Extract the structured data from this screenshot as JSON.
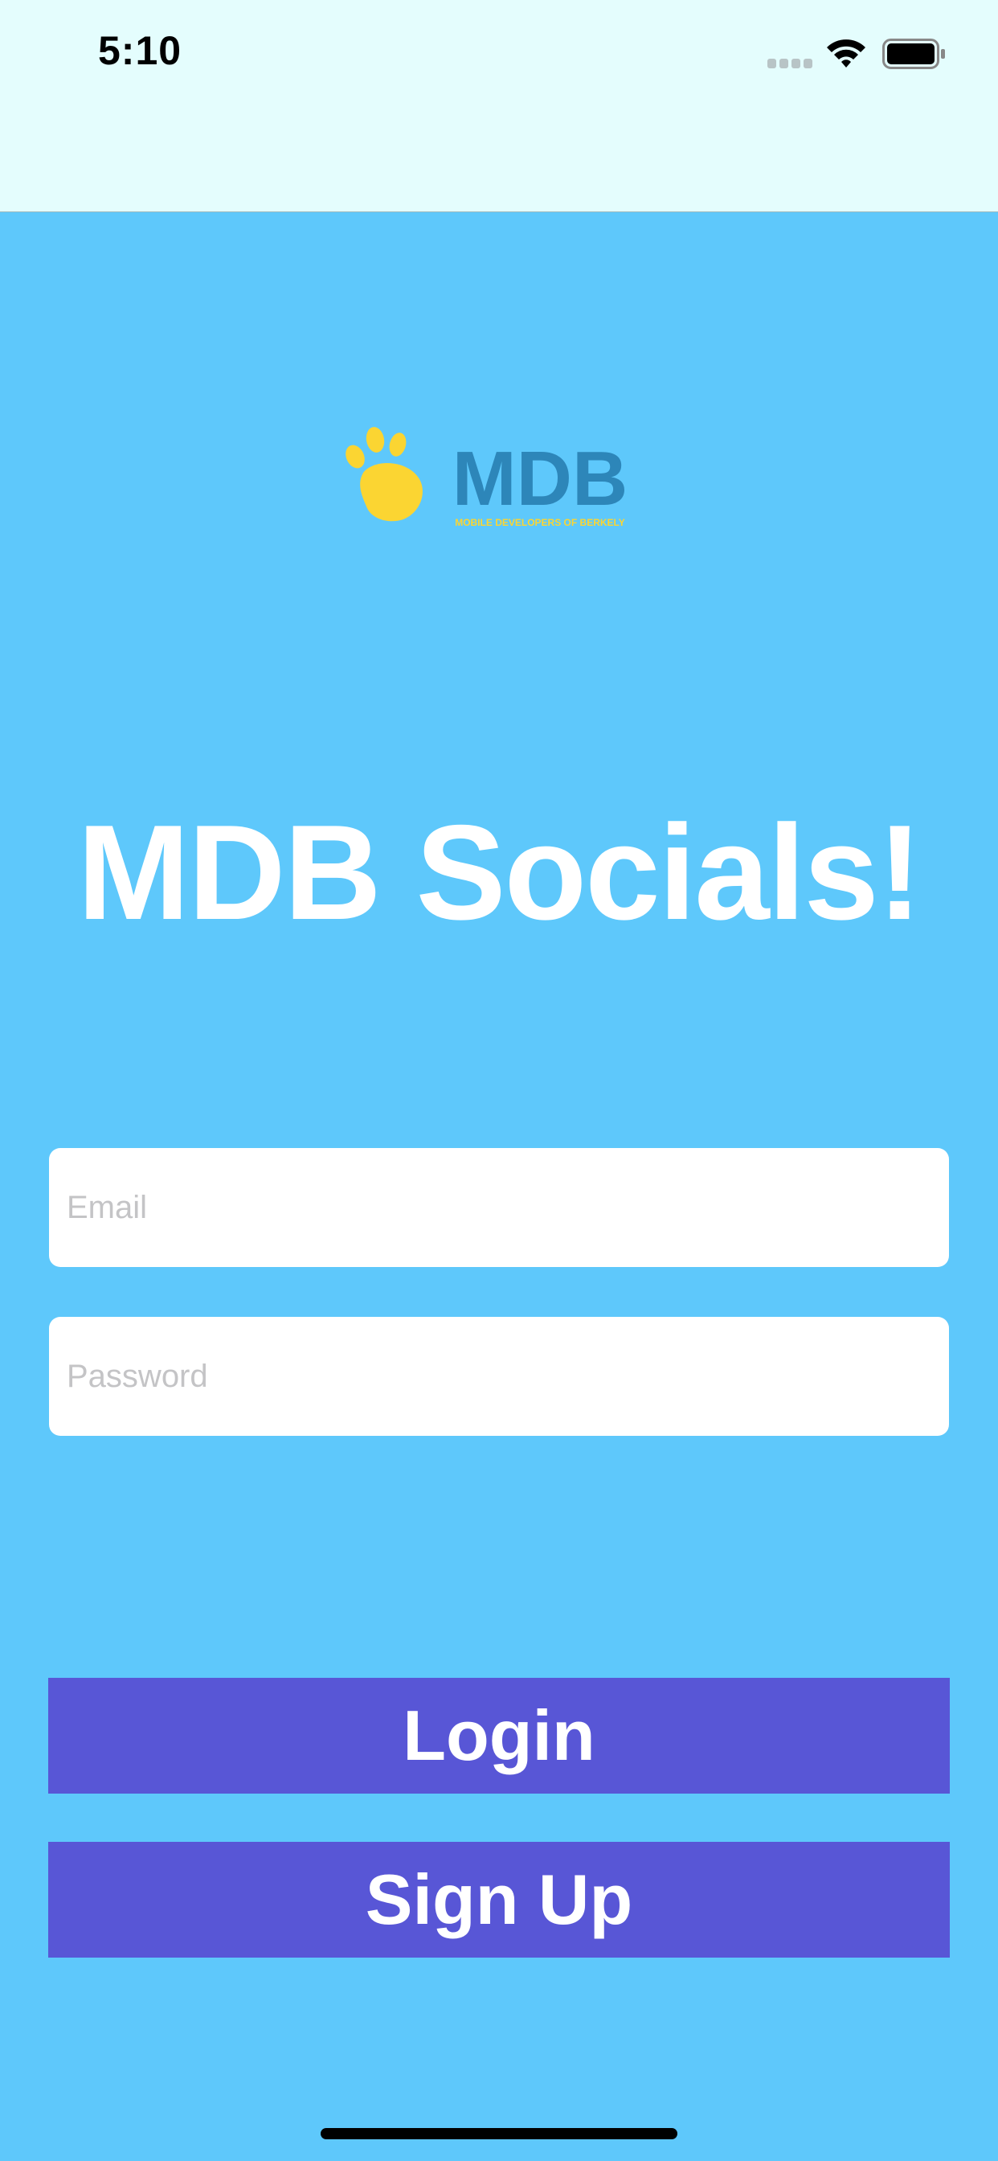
{
  "status_bar": {
    "time": "5:10",
    "signal_icon": "cellular-signal-icon",
    "wifi_icon": "wifi-icon",
    "battery_icon": "battery-icon"
  },
  "logo": {
    "wordmark": "MDB",
    "tagline": "MOBILE DEVELOPERS OF BERKELY",
    "paw_color": "#fbd532",
    "wordmark_color": "#2d86b9"
  },
  "title": "MDB Socials!",
  "form": {
    "email": {
      "placeholder": "Email",
      "value": ""
    },
    "password": {
      "placeholder": "Password",
      "value": ""
    }
  },
  "buttons": {
    "login": "Login",
    "signup": "Sign Up"
  },
  "colors": {
    "background": "#5ec8fb",
    "status_bar_bg": "#e4fdfd",
    "button": "#5856d6",
    "title": "#ffffff"
  }
}
